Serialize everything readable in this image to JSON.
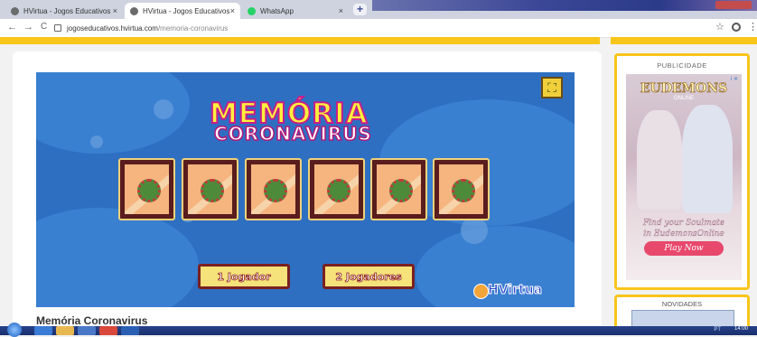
{
  "browser": {
    "tabs": [
      {
        "label": "HVirtua - Jogos Educativos",
        "icon_color": "#6b6b6b",
        "active": false
      },
      {
        "label": "HVirtua - Jogos Educativos",
        "icon_color": "#6b6b6b",
        "active": true
      },
      {
        "label": "WhatsApp",
        "icon_color": "#25d366",
        "active": false
      }
    ],
    "new_tab_symbol": "+",
    "close_symbol": "×",
    "nav": {
      "back": "←",
      "forward": "→",
      "reload": "C"
    },
    "url": {
      "domain": "jogoseducativos.hvirtua.com",
      "path": "/memoria-coronavirus"
    },
    "star_symbol": "☆",
    "menu_symbol": "⋮"
  },
  "game": {
    "logo_line1": "MEMÓRIA",
    "logo_line2": "CORONAVIRUS",
    "fullscreen_symbol": "⛶",
    "card_count": 6,
    "buttons": {
      "one_player": "1 Jogador",
      "two_players": "2 Jogadores"
    },
    "brand": "HVirtua"
  },
  "page": {
    "title": "Memória Coronavirus"
  },
  "sidebar": {
    "ad": {
      "heading": "PUBLICIDADE",
      "logo": "EUDEMONS",
      "logo_sub": "ONLINE",
      "line1": "Find your Soulmate",
      "line2": "in EudemonsOnline",
      "cta": "Play Now",
      "badge": "i ✕"
    },
    "news": {
      "heading": "NOVIDADES"
    }
  },
  "taskbar": {
    "tray": "PT",
    "clock": "14:00"
  },
  "colors": {
    "yellow": "#f8c51a",
    "game_bg": "#2e6fc2",
    "card_frame": "#5a1d1d",
    "card_face": "#f6b47f",
    "button_face": "#f6e27a"
  }
}
